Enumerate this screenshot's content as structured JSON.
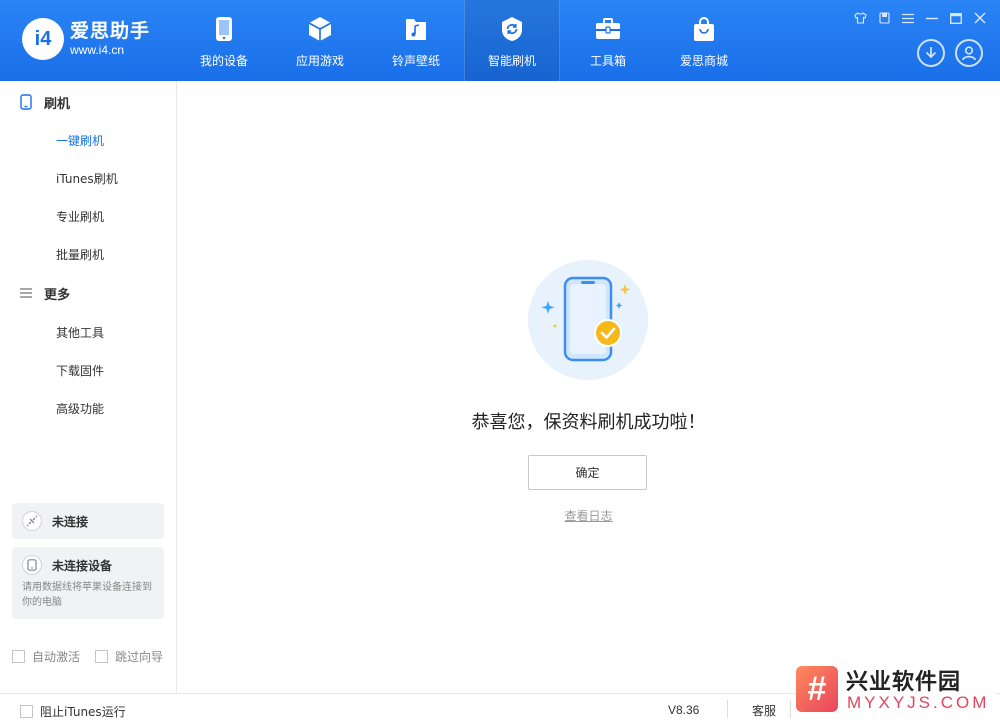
{
  "app": {
    "logo_badge": "i4",
    "name": "爱思助手",
    "url": "www.i4.cn"
  },
  "nav": [
    {
      "label": "我的设备",
      "icon": "phone-icon"
    },
    {
      "label": "应用游戏",
      "icon": "cube-icon"
    },
    {
      "label": "铃声壁纸",
      "icon": "music-file-icon"
    },
    {
      "label": "智能刷机",
      "icon": "refresh-shield-icon",
      "active": true
    },
    {
      "label": "工具箱",
      "icon": "toolbox-icon"
    },
    {
      "label": "爱思商城",
      "icon": "shopping-bag-icon"
    }
  ],
  "window_controls": [
    "skin-icon",
    "pin-icon",
    "menu-icon",
    "minimize-icon",
    "maximize-icon",
    "close-icon"
  ],
  "header_actions": [
    "download-icon",
    "user-icon"
  ],
  "sidebar": {
    "sections": [
      {
        "title": "刷机",
        "icon": "phone-outline-icon",
        "items": [
          {
            "label": "一键刷机",
            "active": true
          },
          {
            "label": "iTunes刷机"
          },
          {
            "label": "专业刷机"
          },
          {
            "label": "批量刷机"
          }
        ]
      },
      {
        "title": "更多",
        "icon": "list-icon",
        "items": [
          {
            "label": "其他工具"
          },
          {
            "label": "下载固件"
          },
          {
            "label": "高级功能"
          }
        ]
      }
    ],
    "connection_status": "未连接",
    "device_status": "未连接设备",
    "device_hint": "请用数据线将苹果设备连接到你的电脑",
    "auto_activate": "自动激活",
    "skip_guide": "跳过向导"
  },
  "main": {
    "message": "恭喜您，保资料刷机成功啦！",
    "confirm": "确定",
    "view_log": "查看日志"
  },
  "footer": {
    "block_itunes": "阻止iTunes运行",
    "version": "V8.36",
    "service": "客服"
  },
  "watermark": {
    "mark": "#",
    "title": "兴业软件园",
    "url": "MYXYJS.COM"
  },
  "colors": {
    "header_blue": "#1a6fe8",
    "accent_blue": "#1a6fe8",
    "success_yellow": "#f6b91a",
    "hero_bg": "#e7f2fd"
  }
}
